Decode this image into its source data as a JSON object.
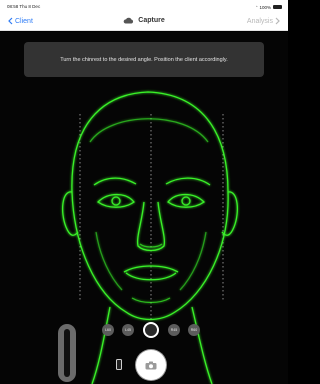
{
  "status_bar": {
    "time": "08:58  Thu 8 Dec",
    "battery": "100%"
  },
  "nav": {
    "back_label": "Client",
    "title": "Capture",
    "right_label": "Analysis"
  },
  "banner": {
    "text": "Turn the chinrest to the desired angle. Position the client accordingly."
  },
  "angle_buttons": [
    "L60",
    "L45",
    "R45",
    "R60"
  ],
  "colors": {
    "accent": "#2f7cf6",
    "face_line": "#3cff2a",
    "guide_line": "#d8d8d8"
  },
  "icons": {
    "back": "chevron-left-icon",
    "cloud": "cloud-icon",
    "forward": "chevron-right-icon",
    "camera": "camera-icon",
    "device": "phone-icon"
  }
}
